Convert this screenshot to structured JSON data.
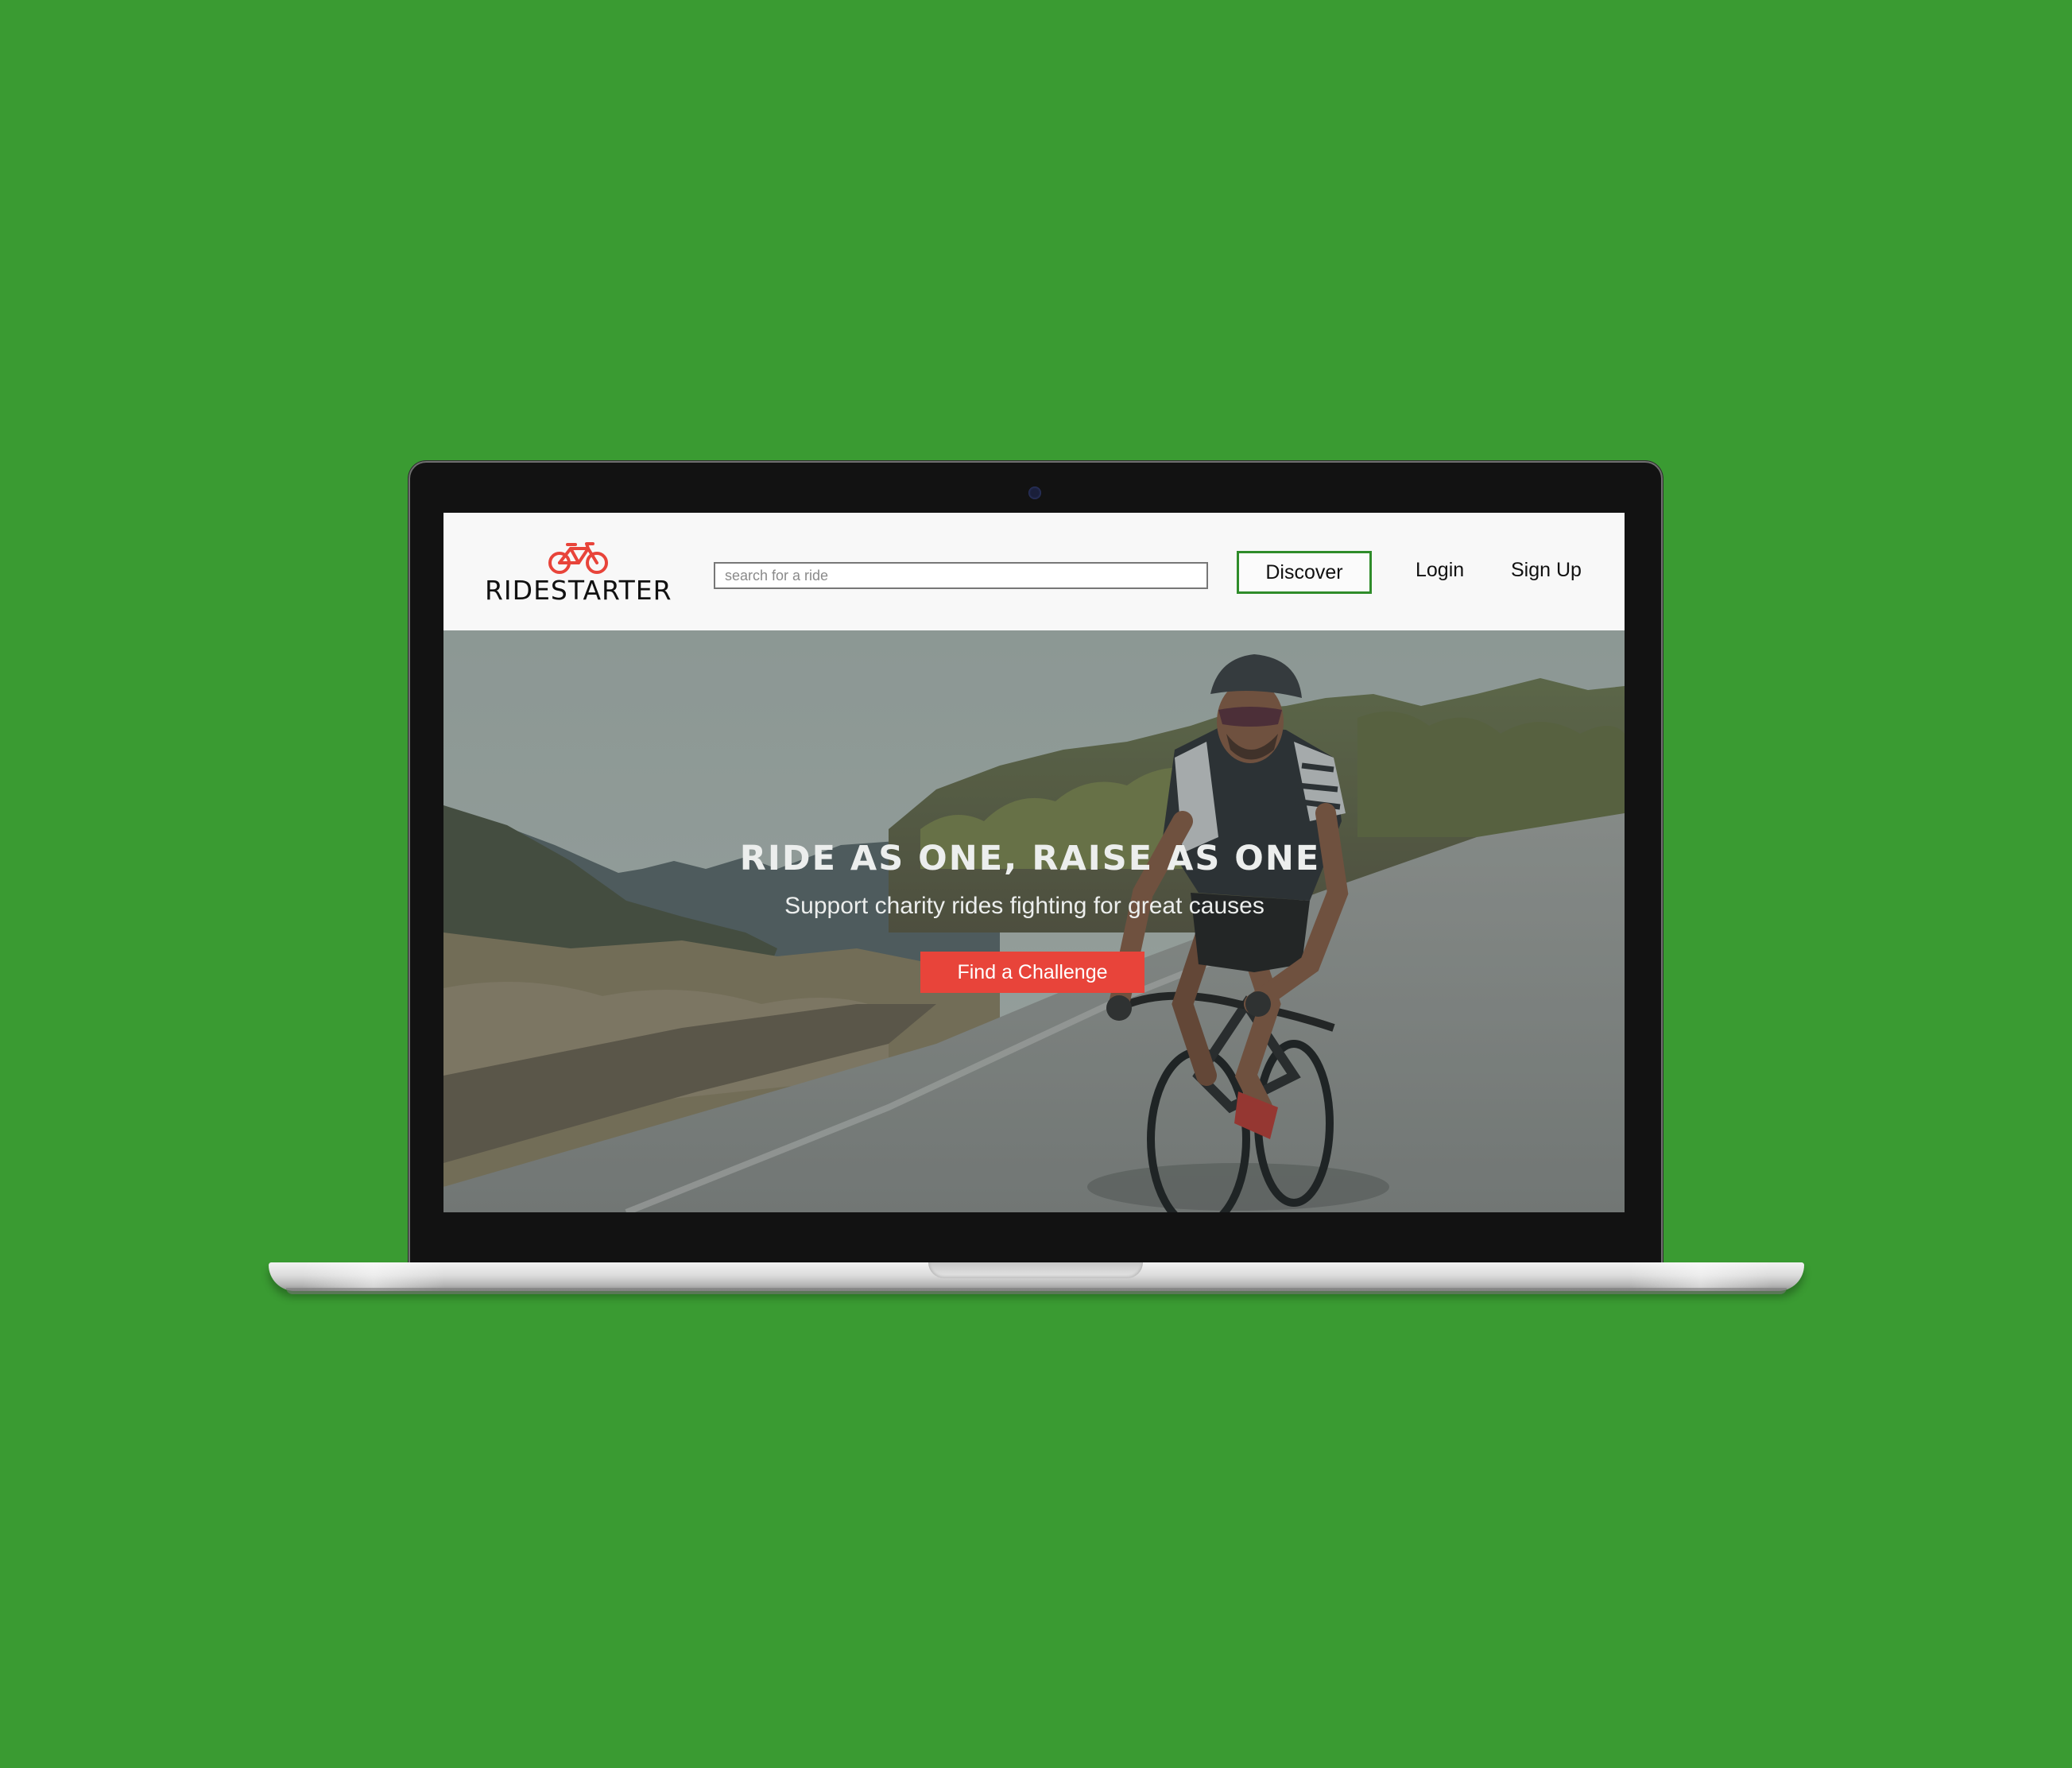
{
  "brand": {
    "name": "RIDESTARTER",
    "logo_icon": "bicycle-icon",
    "accent_color": "#e8443a"
  },
  "header": {
    "search_placeholder": "search for a ride",
    "discover_label": "Discover",
    "login_label": "Login",
    "signup_label": "Sign Up"
  },
  "hero": {
    "heading": "RIDE AS ONE, RAISE AS ONE",
    "subheading": "Support charity rides fighting for great causes",
    "cta_label": "Find a Challenge"
  },
  "colors": {
    "page_background": "#3a9b32",
    "discover_border": "#2f8c2a",
    "cta_background": "#e8443a"
  }
}
